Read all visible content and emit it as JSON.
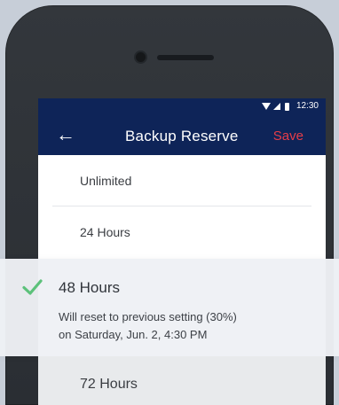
{
  "status_bar": {
    "time": "12:30"
  },
  "header": {
    "back_glyph": "←",
    "title": "Backup Reserve",
    "save_label": "Save"
  },
  "options": [
    {
      "label": "Unlimited"
    },
    {
      "label": "24 Hours"
    },
    {
      "label": "48 Hours"
    },
    {
      "label": "72 Hours"
    }
  ],
  "selected_option": {
    "label": "48 Hours",
    "description_lines": [
      "Will reset to previous setting (30%)",
      "on Saturday, Jun. 2, 4:30 PM"
    ]
  },
  "icons": {
    "back": "arrow-left-icon",
    "selected": "check-icon"
  },
  "colors": {
    "app_bar": "#0e2458",
    "save": "#e63d48",
    "selected_check": "#5cc17a"
  }
}
